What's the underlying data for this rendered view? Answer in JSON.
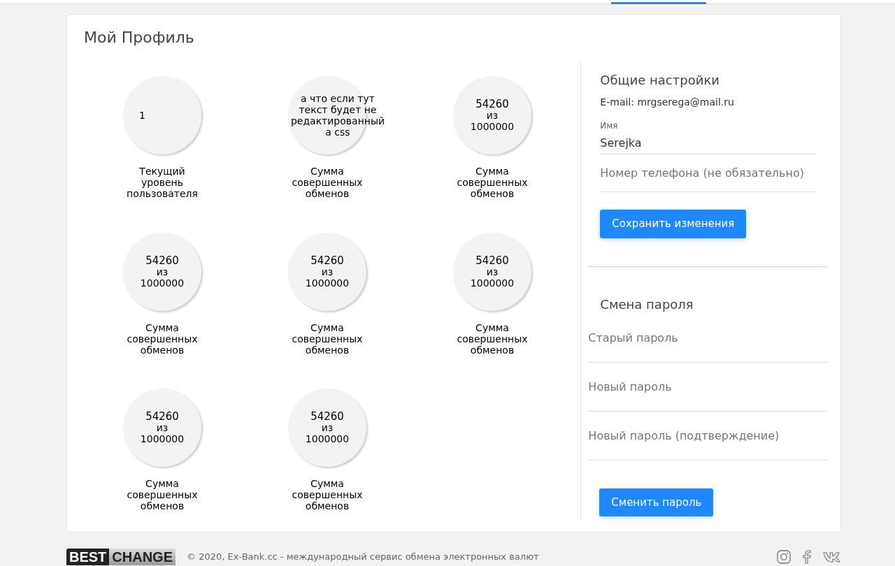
{
  "page": {
    "title": "Мой Профиль"
  },
  "stats": [
    {
      "kind": "level",
      "value": "1",
      "label": "Текущий уровень пользователя"
    },
    {
      "kind": "note",
      "value": "а что если тут текст будет не редактированный а css",
      "label": "Сумма совершенных обменов"
    },
    {
      "kind": "progress",
      "value": "54260",
      "sep": "из",
      "total": "1000000",
      "label": "Сумма совершенных обменов"
    },
    {
      "kind": "progress",
      "value": "54260",
      "sep": "из",
      "total": "1000000",
      "label": "Сумма совершенных обменов"
    },
    {
      "kind": "progress",
      "value": "54260",
      "sep": "из",
      "total": "1000000",
      "label": "Сумма совершенных обменов"
    },
    {
      "kind": "progress",
      "value": "54260",
      "sep": "из",
      "total": "1000000",
      "label": "Сумма совершенных обменов"
    },
    {
      "kind": "progress",
      "value": "54260",
      "sep": "из",
      "total": "1000000",
      "label": "Сумма совершенных обменов"
    },
    {
      "kind": "progress",
      "value": "54260",
      "sep": "из",
      "total": "1000000",
      "label": "Сумма совершенных обменов"
    }
  ],
  "general_settings": {
    "heading": "Общие настройки",
    "email": "E-mail: mrgserega@mail.ru",
    "name_label": "Имя",
    "name_value": "Serejka",
    "phone_placeholder": "Номер телефона (не обязательно)",
    "button": "Сохранить изменения"
  },
  "password_change": {
    "heading": "Смена пароля",
    "fields": [
      {
        "placeholder": "Старый пароль"
      },
      {
        "placeholder": "Новый пароль"
      },
      {
        "placeholder": "Новый пароль (подтверждение)"
      }
    ],
    "button": "Сменить пароль"
  },
  "footer": {
    "logo": [
      "BEST",
      "CHANGE"
    ],
    "copyright": "© 2020, Ex-Bank.cc - международный сервис обмена электронных валют"
  }
}
